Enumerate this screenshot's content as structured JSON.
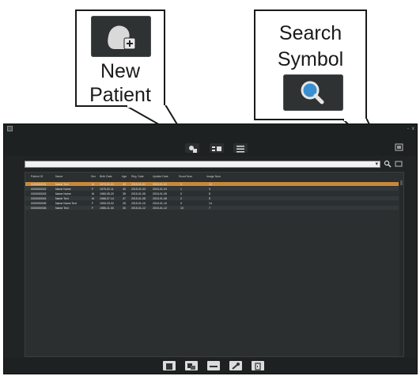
{
  "callouts": {
    "new_patient": {
      "line1": "New",
      "line2": "Patient",
      "icon": "new-patient-icon"
    },
    "search_symbol": {
      "line1": "Search",
      "line2": "Symbol",
      "icon": "magnifier-icon"
    }
  },
  "app": {
    "window_controls": [
      "-",
      "x"
    ],
    "toolbar": {
      "icons": [
        "new-patient-icon",
        "image-list-icon",
        "list-icon"
      ]
    },
    "exit_icon": "exit-icon",
    "search": {
      "value": "",
      "arrow": "▾"
    },
    "table": {
      "columns": [
        "Patient ID",
        "Name",
        "Sex",
        "Birth Date",
        "Age",
        "Reg. Date",
        "Update Date",
        "Scout Num",
        "Image Num"
      ],
      "rows": [
        [
          "0000000001",
          "Name Text",
          "M",
          "1970-01-01",
          "45",
          "2015-01-01",
          "2015-01-01",
          "0",
          "12"
        ],
        [
          "0000000002",
          "Name Name",
          "F",
          "1975-02-11",
          "40",
          "2015-01-03",
          "2015-01-03",
          "1",
          "3"
        ],
        [
          "0000000003",
          "Name Name",
          "M",
          "1980-05-20",
          "35",
          "2015-01-05",
          "2015-01-05",
          "0",
          "8"
        ],
        [
          "0000000004",
          "Name Text",
          "M",
          "1968-07-14",
          "47",
          "2015-01-08",
          "2015-01-08",
          "2",
          "5"
        ],
        [
          "0000000005",
          "Name Name Text",
          "F",
          "1990-03-02",
          "25",
          "2015-01-10",
          "2015-01-10",
          "0",
          "14"
        ],
        [
          "0000000006",
          "Name Text",
          "F",
          "1985-11-30",
          "30",
          "2015-01-12",
          "2015-01-12",
          "10",
          "7"
        ]
      ]
    },
    "bottom_icons": [
      "report-icon",
      "images-icon",
      "acquire-icon",
      "tools-icon",
      "exit-door-icon"
    ]
  }
}
